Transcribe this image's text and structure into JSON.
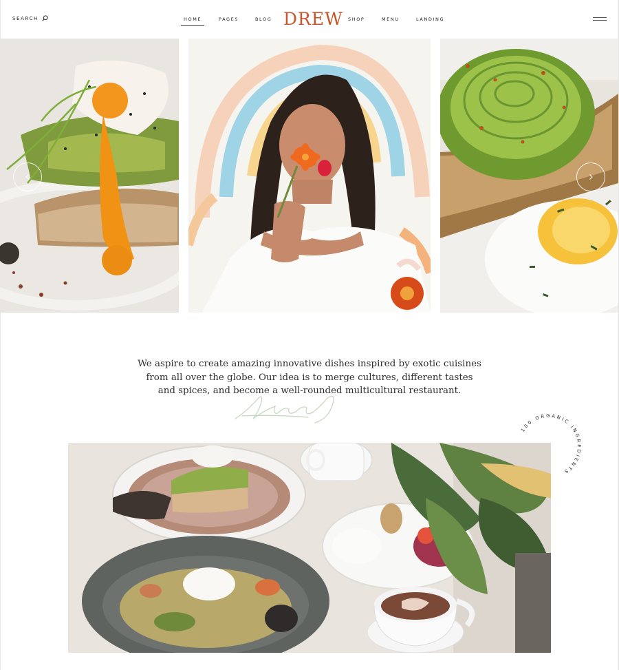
{
  "header": {
    "search_label": "SEARCH",
    "logo": "DREW",
    "nav": [
      {
        "label": "HOME",
        "active": true
      },
      {
        "label": "PAGES"
      },
      {
        "label": "BLOG"
      },
      {
        "label": "SHOP"
      },
      {
        "label": "MENU"
      },
      {
        "label": "LANDING"
      }
    ]
  },
  "slider": {
    "slides": [
      {
        "description": "poached-egg-avocado-toast"
      },
      {
        "description": "woman-smelling-flower"
      },
      {
        "description": "avocado-rose-and-fried-egg"
      }
    ],
    "prev_icon": "chevron-left-icon",
    "next_icon": "chevron-right-icon"
  },
  "intro": {
    "text": "We aspire to create amazing innovative dishes inspired by exotic cuisines from all over the globe. Our idea is to merge cultures, different tastes and spices, and become a well-rounded multicultural restaurant."
  },
  "badge": {
    "text": "100 ORGANIC INGREDIENTS"
  },
  "colors": {
    "accent": "#c9552a",
    "text": "#2e2e2e"
  }
}
